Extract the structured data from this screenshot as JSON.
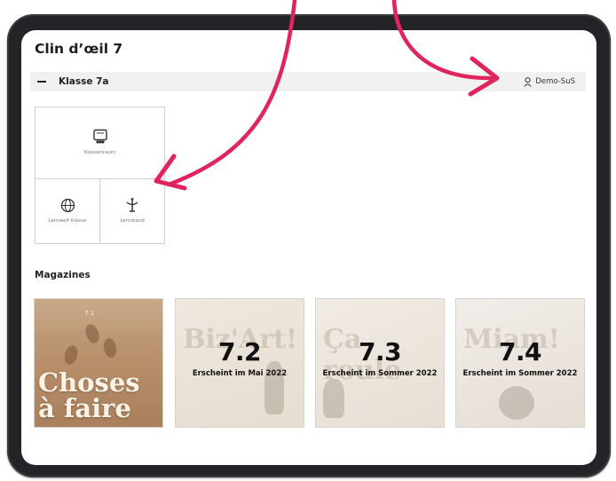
{
  "app": {
    "title": "Clin d’œil 7"
  },
  "class_bar": {
    "class_name": "Klasse 7a",
    "user": "Demo-SuS"
  },
  "tiles": {
    "classroom": "Klassenraum",
    "lernwelt": "Lernwelt Klasse",
    "lernstand": "Lernstand"
  },
  "magazines_section": {
    "title": "Magazines"
  },
  "magazines": [
    {
      "cover_text_line1": "Choses",
      "cover_text_line2": "à faire",
      "issue_small": "7.1"
    },
    {
      "number": "7.2",
      "caption": "Erscheint im Mai 2022",
      "ghost_title": "Biz'Art!"
    },
    {
      "number": "7.3",
      "caption": "Erscheint im Sommer 2022",
      "ghost_title": "Ça roule"
    },
    {
      "number": "7.4",
      "caption": "Erscheint im Sommer 2022",
      "ghost_title": "Miam!"
    }
  ],
  "colors": {
    "arrow": "#e0245e",
    "bezel": "#232427",
    "bar": "#f1f1f1"
  }
}
